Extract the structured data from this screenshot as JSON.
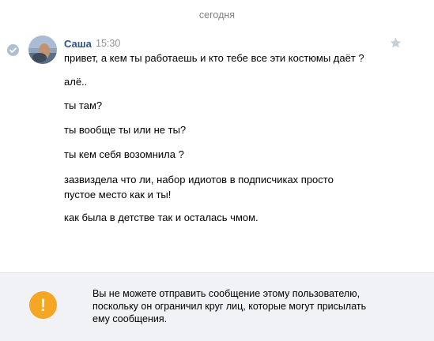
{
  "date_separator": "сегодня",
  "message_group": {
    "author": "Саша",
    "time": "15:30",
    "messages": [
      "привет, а кем ты работаешь и кто тебе все эти костюмы даёт ?",
      "алё..",
      "ты там?",
      "ты вообще ты или не ты?",
      "ты кем себя возомнила ?",
      "зазвиздела что ли, набор идиотов в подписчиках просто\nпустое место как и ты!",
      "как была в детстве так и осталась чмом."
    ]
  },
  "notice": {
    "icon": "!",
    "text": "Вы не можете отправить сообщение этому пользователю,\nпоскольку он ограничил круг лиц, которые могут присылать\nему сообщения."
  },
  "colors": {
    "author": "#2a5885",
    "time": "#939393",
    "warning": "#f5a623",
    "notice_bg": "#f0f2f5"
  }
}
